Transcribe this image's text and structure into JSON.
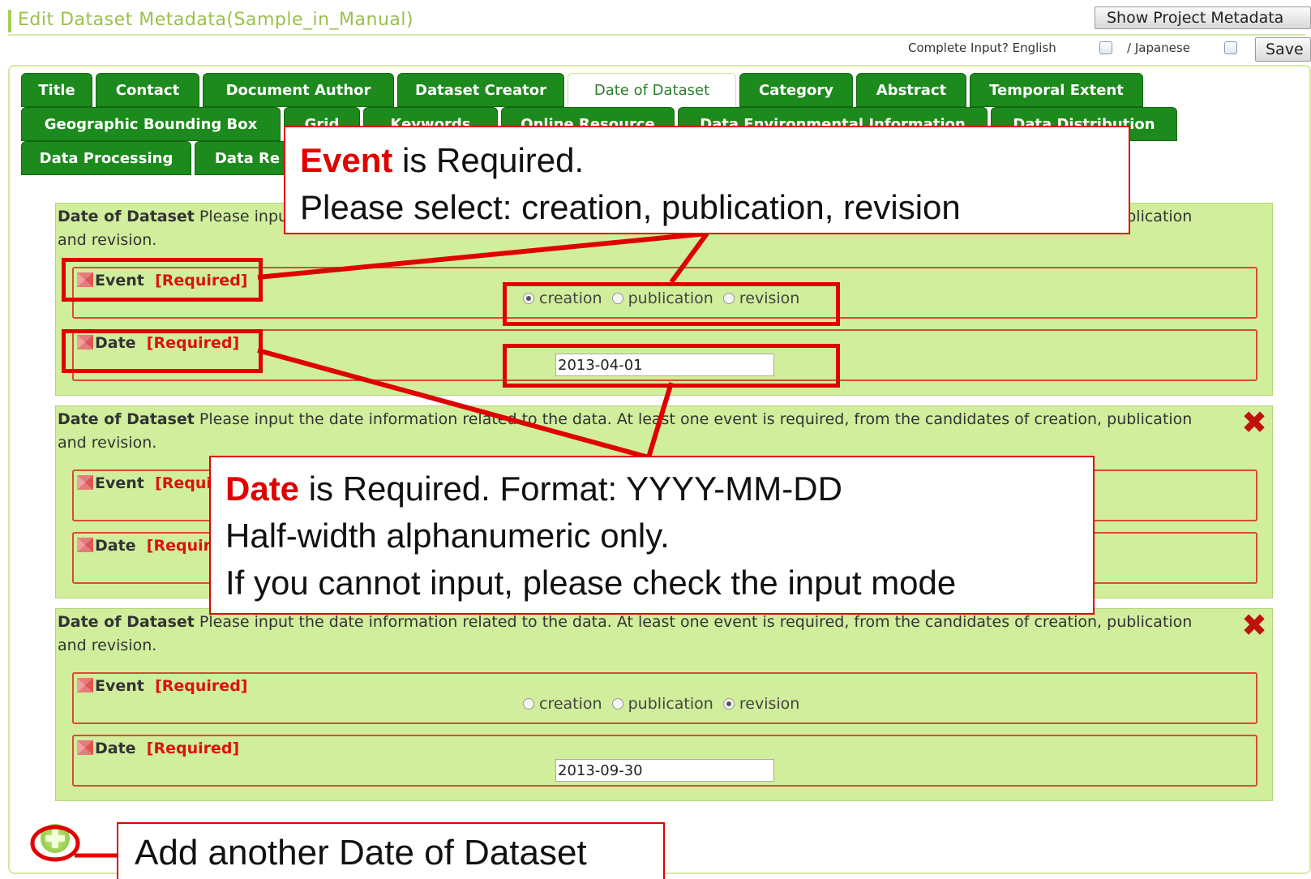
{
  "header": {
    "title": "Edit Dataset Metadata(Sample_in_Manual)",
    "show_project_button": "Show Project Metadata",
    "complete_input_label": "Complete Input? English",
    "slash_japanese": "/ Japanese",
    "save_button": "Save"
  },
  "tabs": {
    "title": "Title",
    "contact": "Contact",
    "document_author": "Document Author",
    "dataset_creator": "Dataset Creator",
    "date_of_dataset": "Date of Dataset",
    "category": "Category",
    "abstract": "Abstract",
    "temporal_extent": "Temporal Extent",
    "geographic_bounding_box": "Geographic Bounding Box",
    "grid": "Grid",
    "keywords": "Keywords",
    "online_resource": "Online Resource",
    "data_environmental_information": "Data Environmental Information",
    "data_distribution": "Data Distribution",
    "data_processing": "Data Processing",
    "data_remarks": "Data Re"
  },
  "section": {
    "heading": "Date of Dataset",
    "description": " Please input the date information related to the data. At least one event is required, from the candidates of creation, publication and revision.",
    "event_label": "Event",
    "date_label": "Date",
    "required": "[Required]",
    "options": [
      "creation",
      "publication",
      "revision"
    ]
  },
  "entries": [
    {
      "event_selected": "creation",
      "date_value": "2013-04-01"
    },
    {
      "event_selected": "",
      "date_value": ""
    },
    {
      "event_selected": "revision",
      "date_value": "2013-09-30"
    }
  ],
  "callouts": {
    "event_bold": "Event",
    "event_line1_rest": " is Required.",
    "event_line2": "Please select: creation, publication, revision",
    "date_bold": "Date",
    "date_line1_rest": " is Required. Format: YYYY-MM-DD",
    "date_line2": "Half-width alphanumeric only.",
    "date_line3": "If you cannot input, please check the input mode",
    "add_text": "Add another Date of Dataset"
  },
  "colors": {
    "tab_green": "#1c8a1c",
    "section_bg": "#d0ee9c",
    "annotation_red": "#e00000",
    "required_red": "#d11"
  }
}
